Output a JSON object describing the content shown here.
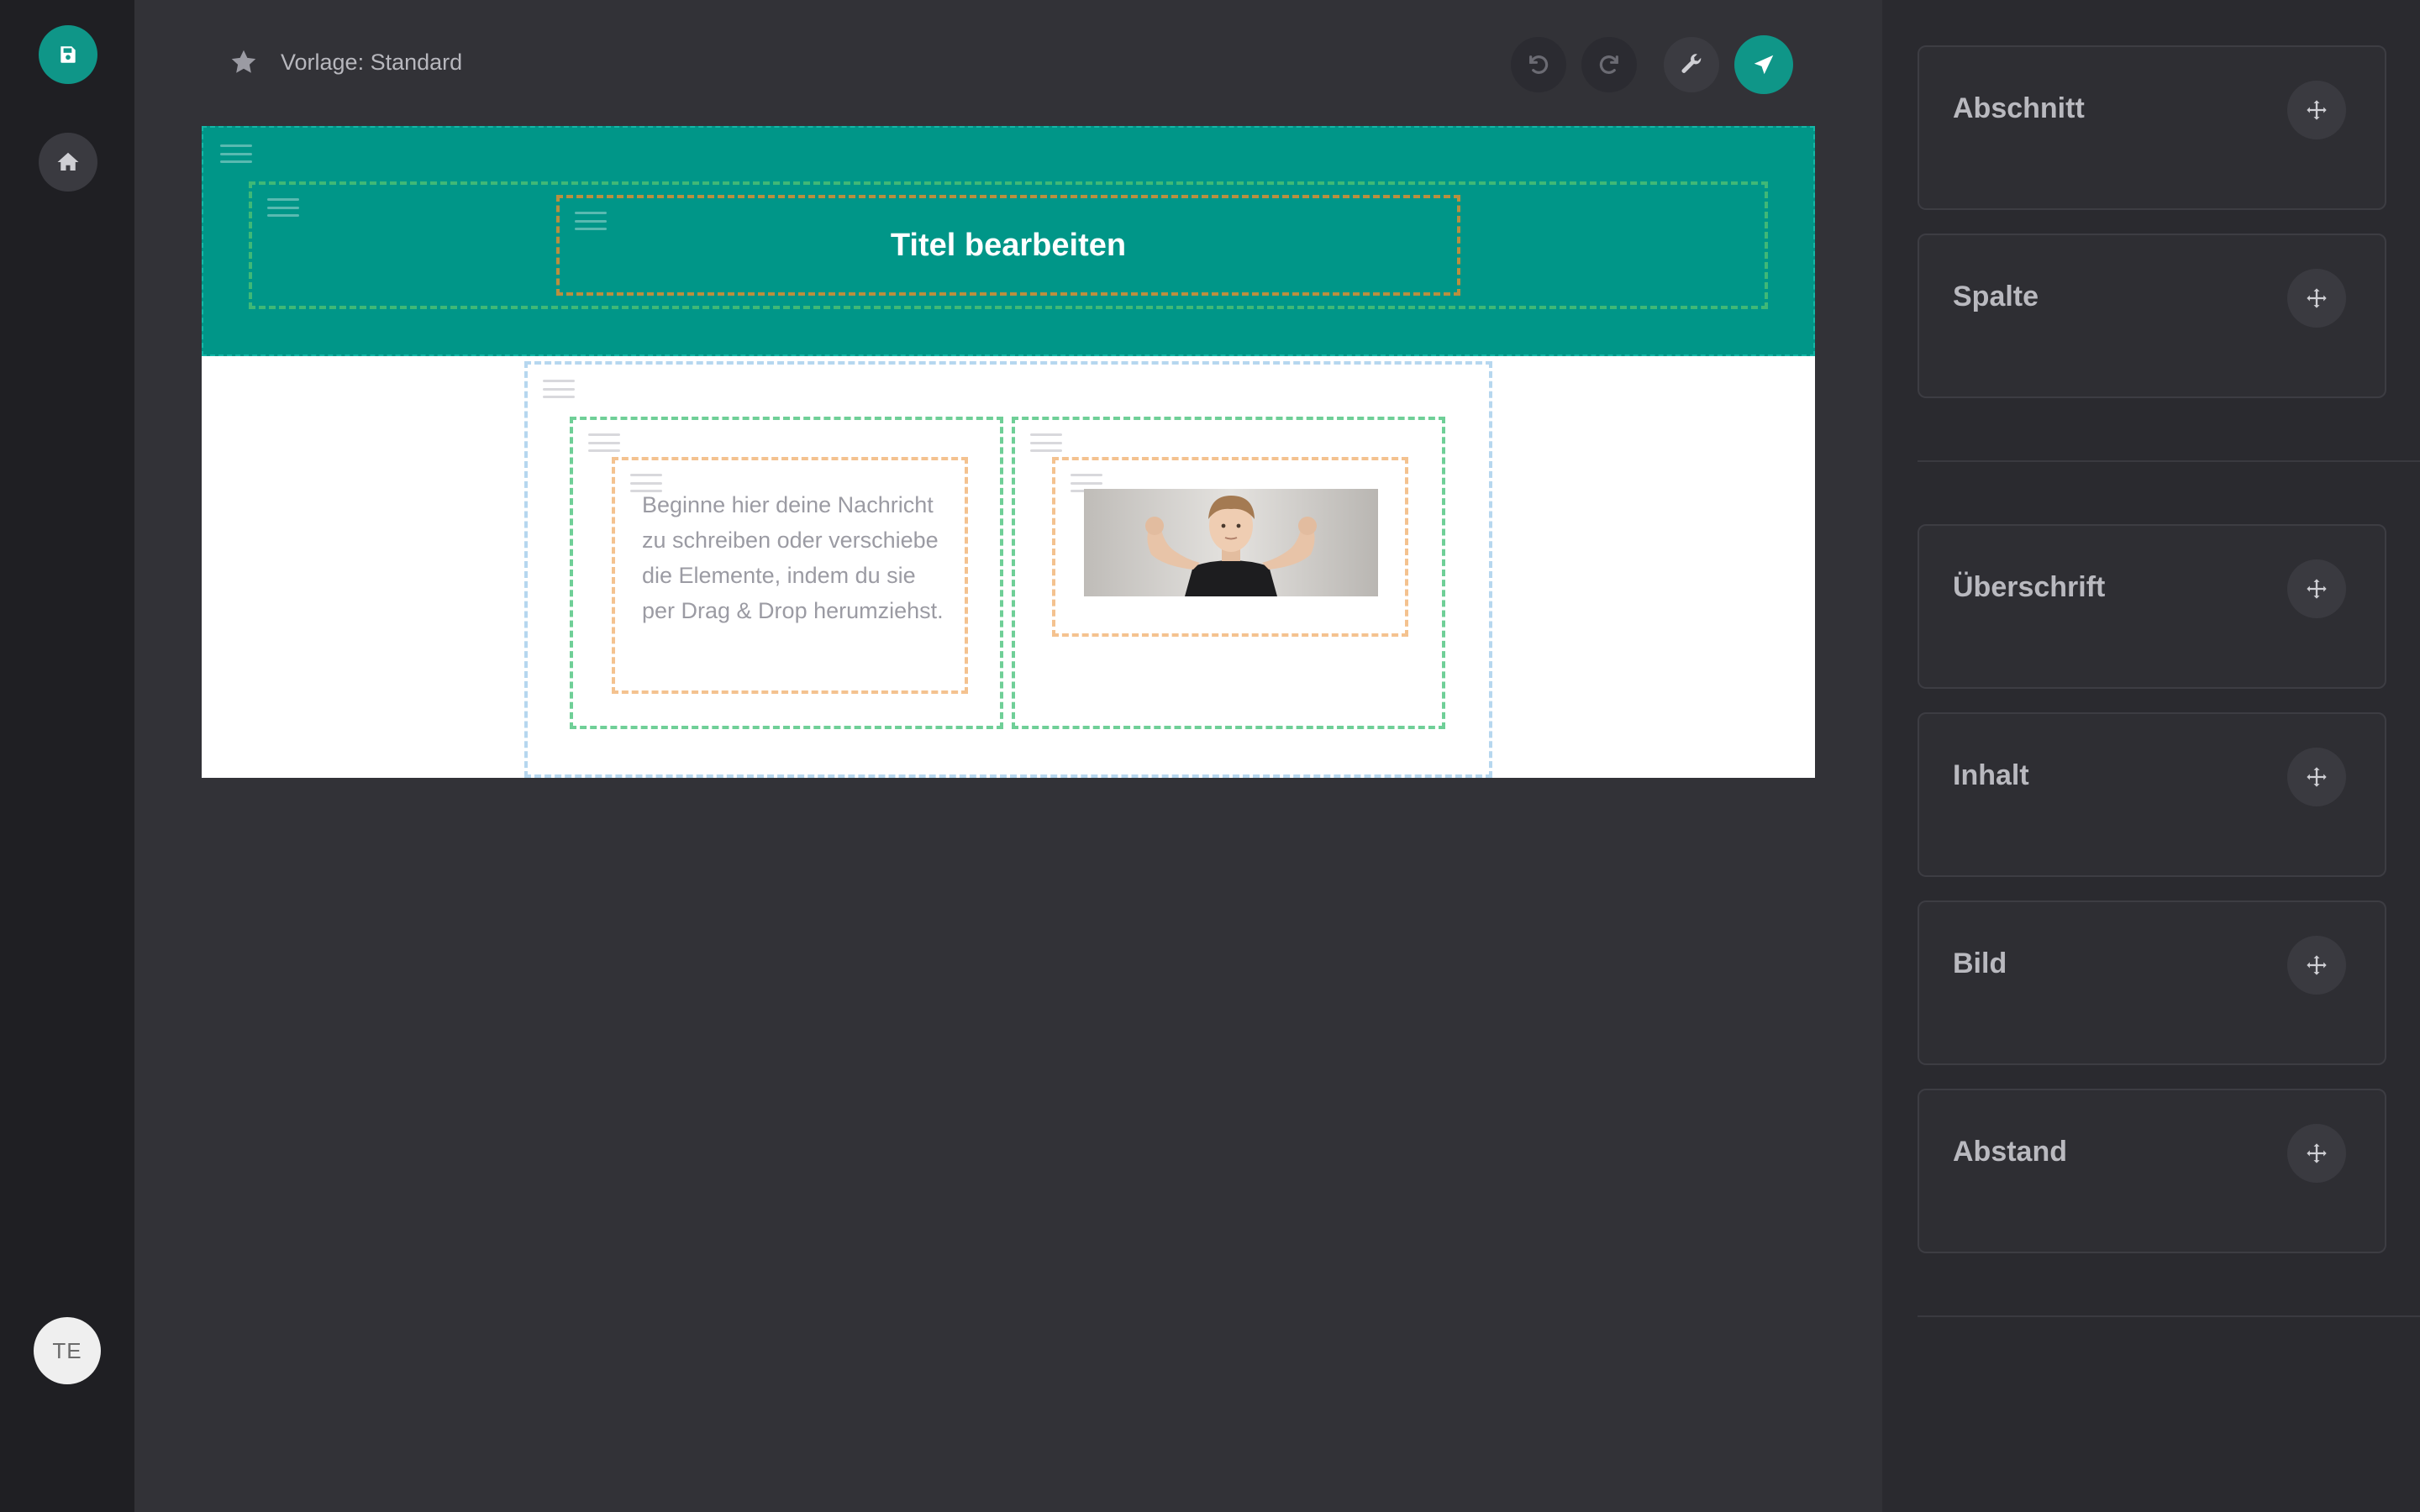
{
  "rail": {
    "save_icon": "save-icon",
    "home_icon": "home-icon",
    "avatar_initials": "TE"
  },
  "topbar": {
    "template_label": "Vorlage: Standard",
    "star_icon": "star-icon",
    "tools": [
      "undo-icon",
      "redo-icon",
      "wrench-icon",
      "send-icon"
    ]
  },
  "canvas": {
    "header_title": "Titel bearbeiten",
    "body_text": "Beginne hier deine Nachricht zu schreiben oder verschiebe die Elemente, indem du sie per Drag & Drop herumziehst.",
    "image_alt": "boy-flexing-photo"
  },
  "panel": {
    "blocks": [
      {
        "label": "Abschnitt"
      },
      {
        "label": "Spalte"
      },
      {
        "label": "Überschrift"
      },
      {
        "label": "Inhalt"
      },
      {
        "label": "Bild"
      },
      {
        "label": "Abstand"
      }
    ]
  },
  "colors": {
    "accent": "#0f9688",
    "header_band": "#009688",
    "rail": "#1f1f23",
    "workspace": "#323237",
    "panel": "#2a2a2f"
  }
}
